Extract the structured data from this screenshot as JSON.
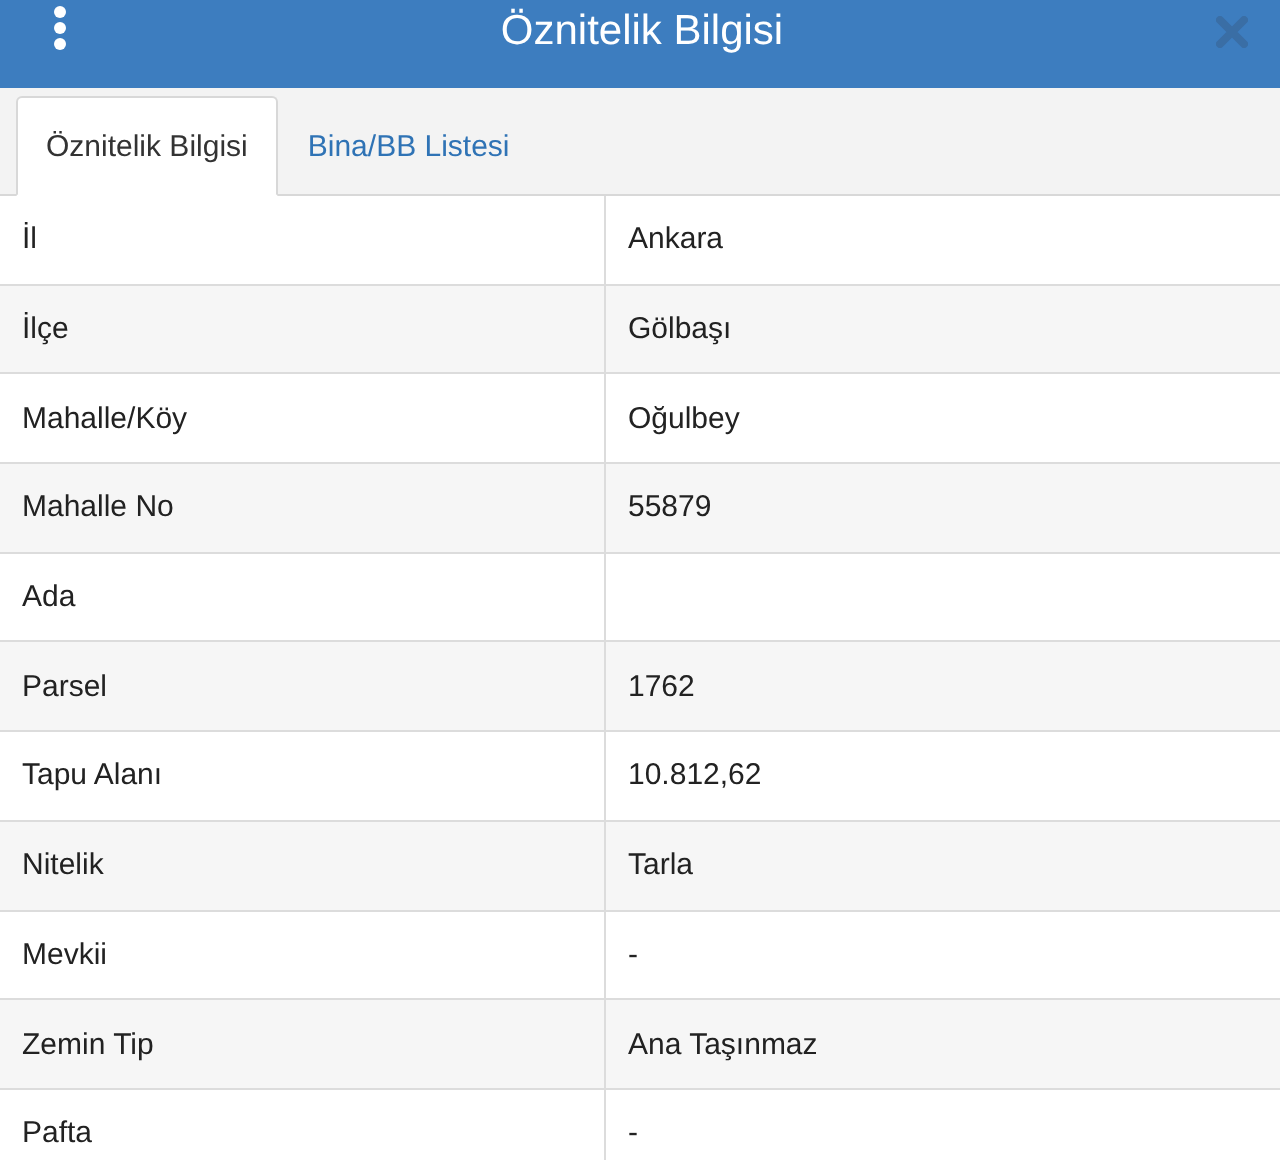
{
  "header": {
    "title": "Öznitelik Bilgisi"
  },
  "tabs": [
    {
      "label": "Öznitelik Bilgisi",
      "selected": true
    },
    {
      "label": "Bina/BB Listesi",
      "selected": false
    }
  ],
  "table": {
    "rows": [
      {
        "label": "İl",
        "value": "Ankara"
      },
      {
        "label": "İlçe",
        "value": "Gölbaşı"
      },
      {
        "label": "Mahalle/Köy",
        "value": "Oğulbey"
      },
      {
        "label": "Mahalle No",
        "value": "55879"
      },
      {
        "label": "Ada"
      },
      {
        "label": "Parsel",
        "value": "1762"
      },
      {
        "label": "Tapu Alanı",
        "value": "10.812,62"
      },
      {
        "label": "Nitelik",
        "value": "Tarla"
      },
      {
        "label": "Mevkii",
        "value": "-"
      },
      {
        "label": "Zemin Tip",
        "value": "Ana Taşınmaz"
      },
      {
        "label": "Pafta",
        "value": "-"
      }
    ]
  }
}
